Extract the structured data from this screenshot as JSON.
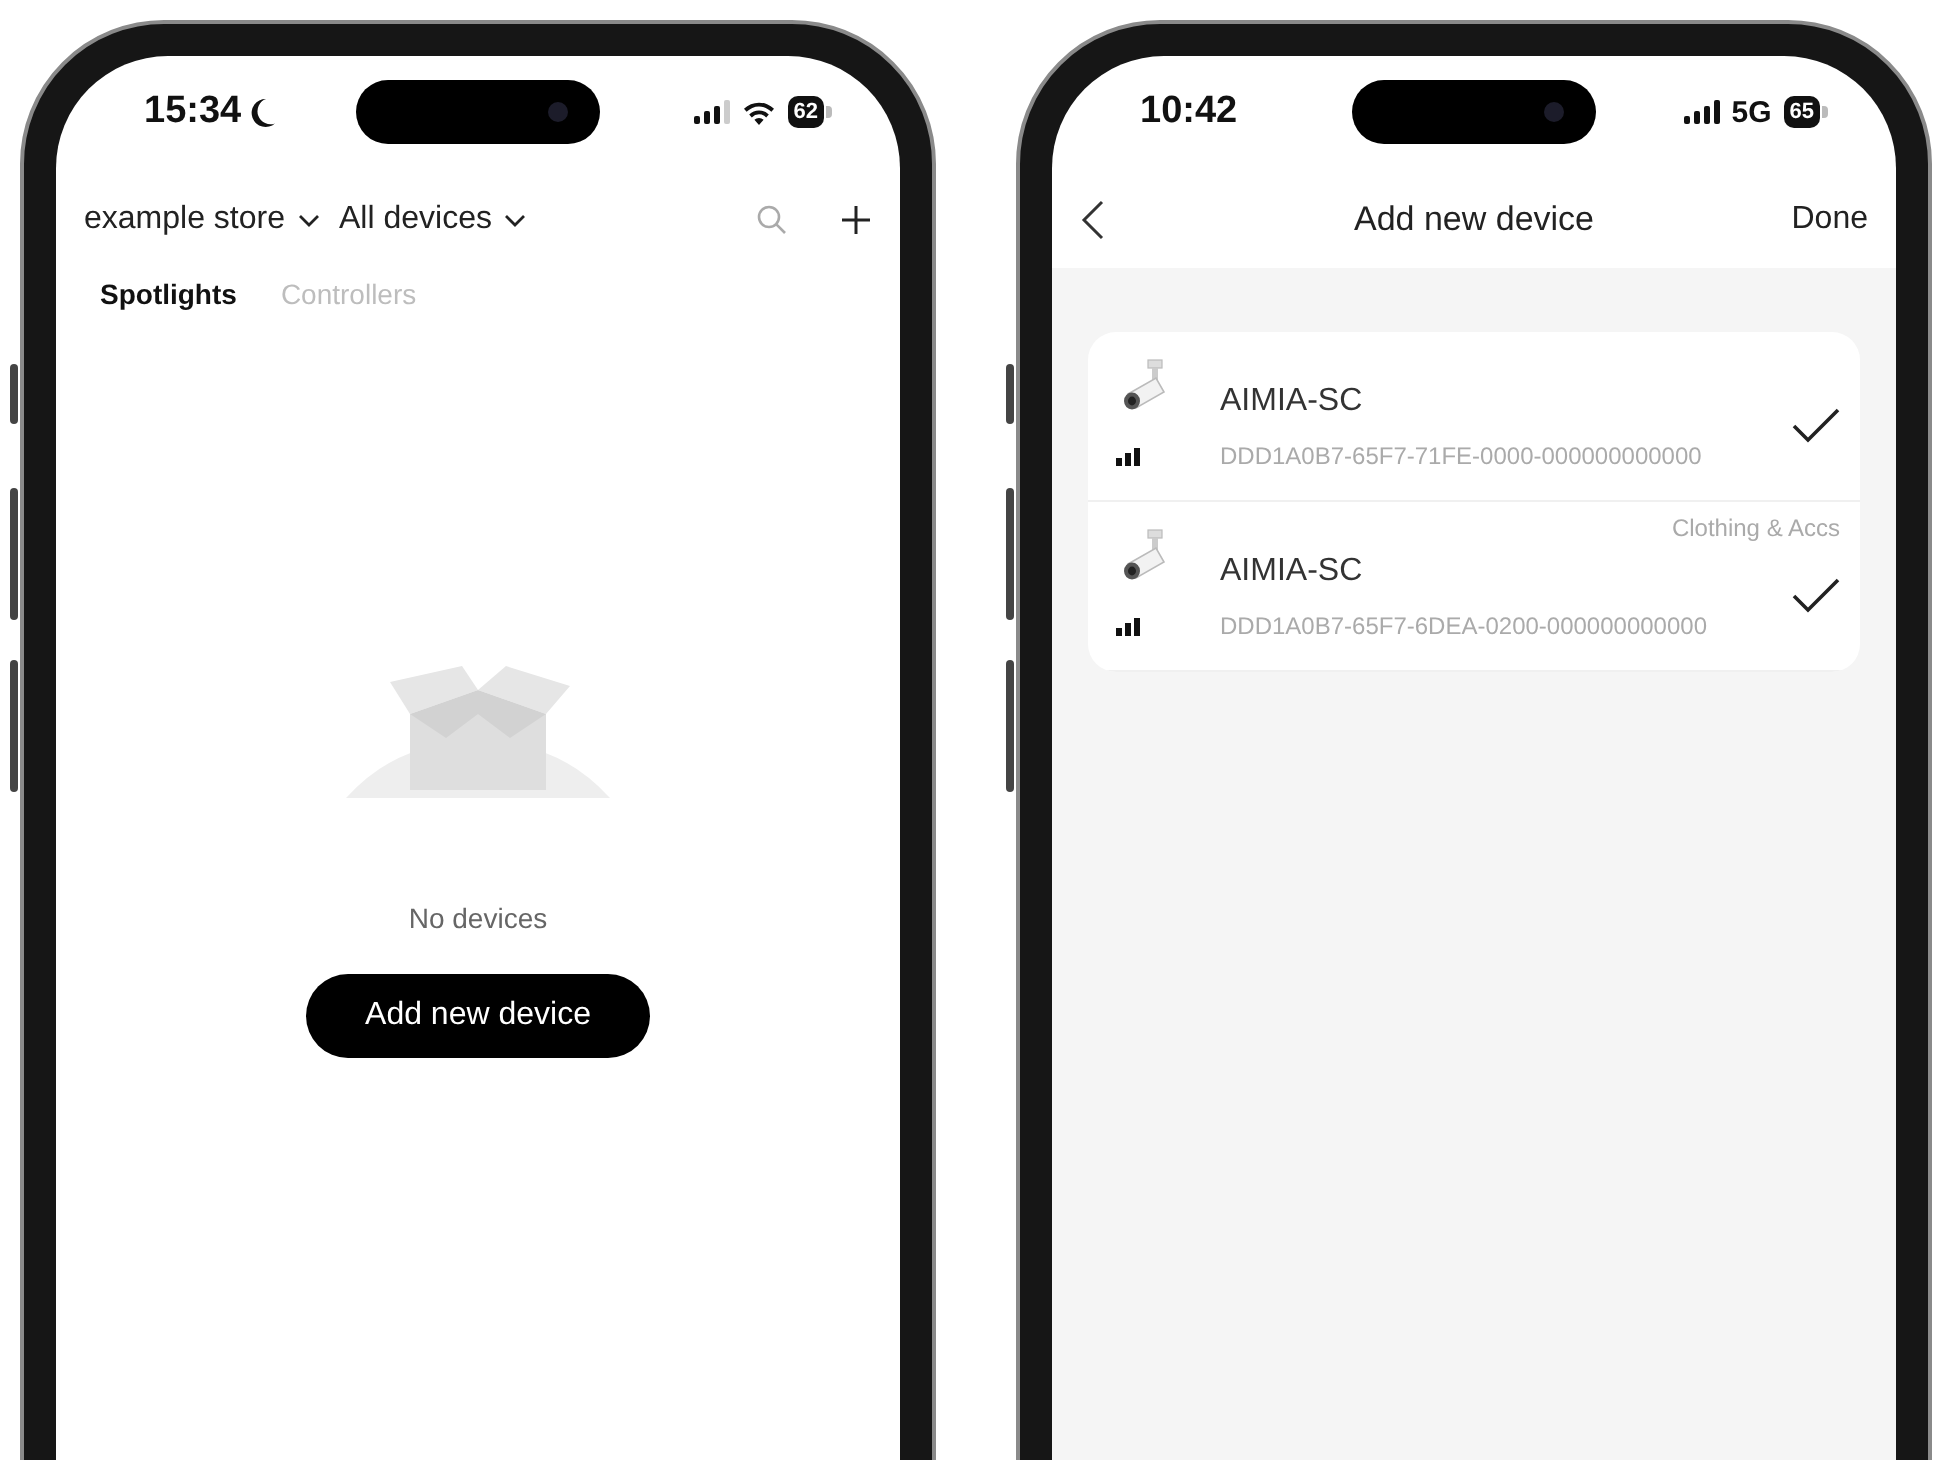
{
  "home_screen": {
    "status_bar": {
      "time": "15:34",
      "focus_mode": true,
      "network": {
        "kind": "wifi"
      },
      "battery": "62"
    },
    "store_selector": "example store",
    "device_filter": "All devices",
    "tabs": [
      {
        "label": "Spotlights",
        "selected": true
      },
      {
        "label": "Controllers",
        "selected": false
      }
    ],
    "empty_state": {
      "message": "No devices"
    },
    "add_button": "Add new device"
  },
  "add_device_screen": {
    "status_bar": {
      "time": "10:42",
      "focus_mode": false,
      "network": {
        "kind": "cellular",
        "label": "5G"
      },
      "battery": "65"
    },
    "title": "Add new device",
    "done_button": "Done",
    "devices": [
      {
        "name": "AIMIA-SC",
        "id": "DDD1A0B7-65F7-71FE-0000-000000000000",
        "checked": true
      },
      {
        "name": "AIMIA-SC",
        "id": "DDD1A0B7-65F7-6DEA-0200-000000000000",
        "group": "Clothing & Accs",
        "checked": true
      }
    ]
  }
}
